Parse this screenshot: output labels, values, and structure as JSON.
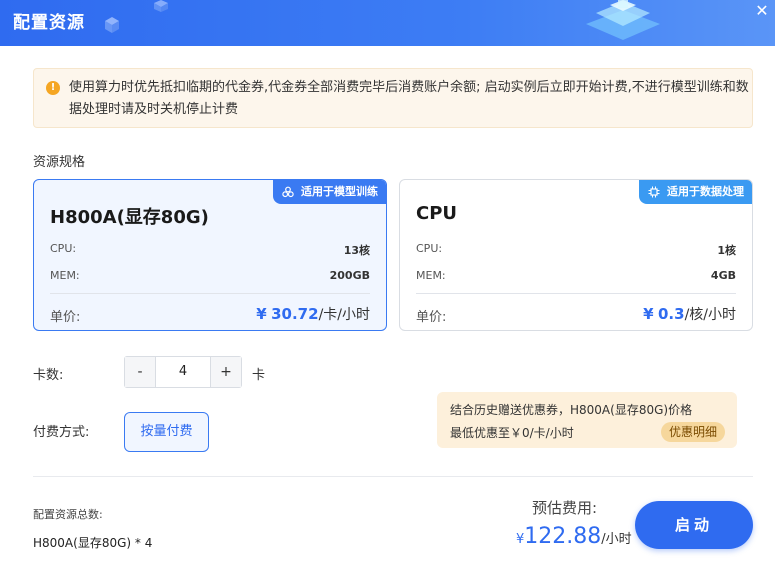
{
  "header": {
    "title": "配置资源"
  },
  "notice": {
    "text": "使用算力时优先抵扣临期的代金券,代金券全部消费完毕后消费账户余额; 启动实例后立即开始计费,不进行模型训练和数据处理时请及时关机停止计费"
  },
  "specs": {
    "label": "资源规格",
    "cards": [
      {
        "badge": "适用于模型训练",
        "name": "H800A(显存80G)",
        "cpu_label": "CPU:",
        "cpu": "13核",
        "mem_label": "MEM:",
        "mem": "200GB",
        "price_label": "单价:",
        "price_currency": "¥",
        "price": "30.72",
        "price_unit": "/卡/小时"
      },
      {
        "badge": "适用于数据处理",
        "name": "CPU",
        "cpu_label": "CPU:",
        "cpu": "1核",
        "mem_label": "MEM:",
        "mem": "4GB",
        "price_label": "单价:",
        "price_currency": "¥",
        "price": "0.3",
        "price_unit": "/核/小时"
      }
    ]
  },
  "quantity": {
    "label": "卡数:",
    "minus": "-",
    "value": "4",
    "plus": "+",
    "unit": "卡"
  },
  "payment": {
    "label": "付费方式:",
    "option": "按量付费"
  },
  "promo": {
    "line1": "结合历史赠送优惠券，H800A(显存80G)价格",
    "line2": "最低优惠至￥0/卡/小时",
    "detail": "优惠明细"
  },
  "summary": {
    "label": "配置资源总数:",
    "value": "H800A(显存80G) * 4"
  },
  "estimate": {
    "label": "预估费用:",
    "currency": "¥",
    "amount": "122.88",
    "unit": "/小时"
  },
  "start_button": "启动",
  "colors": {
    "primary": "#2f6bf0",
    "warning": "#f5a623",
    "promo_bg": "#fdf0db"
  }
}
